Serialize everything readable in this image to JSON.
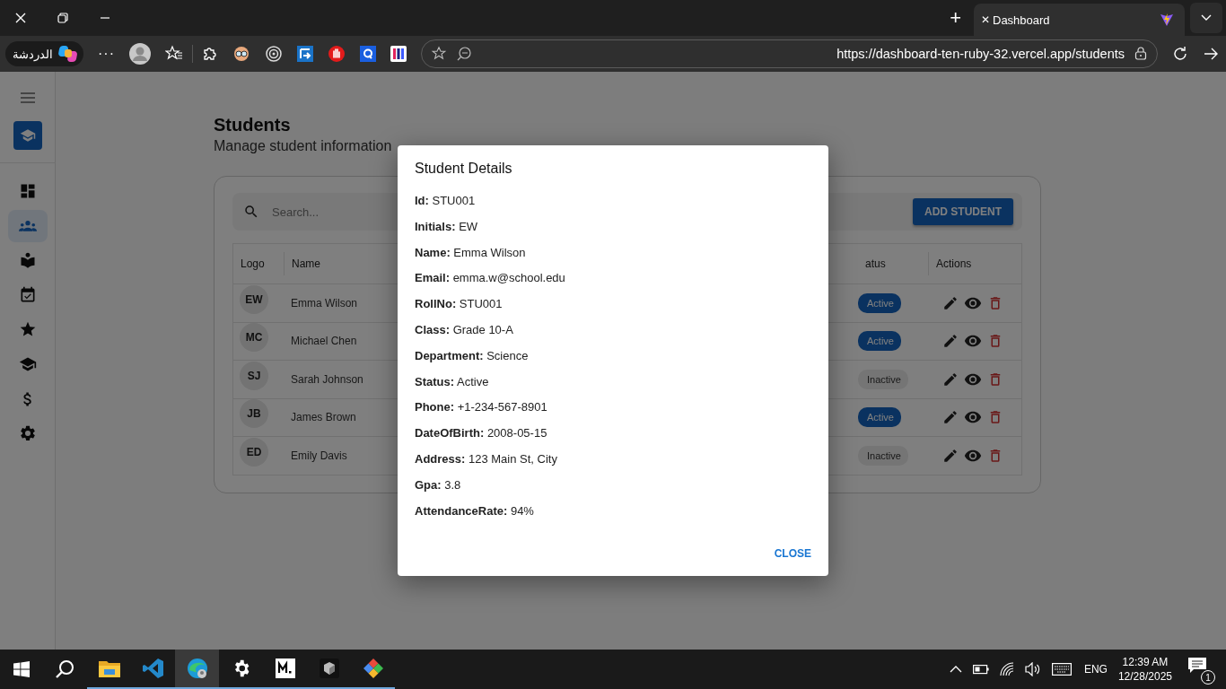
{
  "browser": {
    "tab": {
      "title": "Dashboard",
      "close": "✕"
    },
    "new_tab": "+",
    "copilot_label": "الدردشة",
    "more": "···",
    "url": "https://dashboard-ten-ruby-32.vercel.app/students"
  },
  "sidebar": {
    "items": [
      {
        "selected": false
      },
      {
        "selected": true
      },
      {
        "selected": false
      },
      {
        "selected": false
      },
      {
        "selected": false
      },
      {
        "selected": false
      },
      {
        "selected": false
      },
      {
        "selected": false
      }
    ]
  },
  "page": {
    "title": "Students",
    "subtitle": "Manage student information"
  },
  "search": {
    "placeholder": "Search..."
  },
  "add_button": "ADD STUDENT",
  "table": {
    "columns": [
      "Logo",
      "Name",
      "atus",
      "Actions"
    ],
    "rows": [
      {
        "initials": "EW",
        "name": "Emma Wilson",
        "status": "Active",
        "active": true
      },
      {
        "initials": "MC",
        "name": "Michael Chen",
        "status": "Active",
        "active": true
      },
      {
        "initials": "SJ",
        "name": "Sarah Johnson",
        "status": "Inactive",
        "active": false
      },
      {
        "initials": "JB",
        "name": "James Brown",
        "status": "Active",
        "active": true
      },
      {
        "initials": "ED",
        "name": "Emily Davis",
        "status": "Inactive",
        "active": false
      }
    ]
  },
  "dialog": {
    "title": "Student Details",
    "fields": [
      "**Id:** STU001",
      "**Initials:** EW",
      "**Name:** Emma Wilson",
      "**Email:** emma.w@school.edu",
      "**RollNo:** STU001",
      "**Class:** Grade 10-A",
      "**Department:** Science",
      "**Status:** Active",
      "**Phone:** +1-234-567-8901",
      "**DateOfBirth:** 2008-05-15",
      "**Address:** 123 Main St, City",
      "**Gpa:** 3.8",
      "**AttendanceRate:** 94%"
    ],
    "close": "CLOSE"
  },
  "taskbar": {
    "language": "ENG",
    "time": "12:39 AM",
    "date": "12/28/2025",
    "notifications": "1"
  }
}
